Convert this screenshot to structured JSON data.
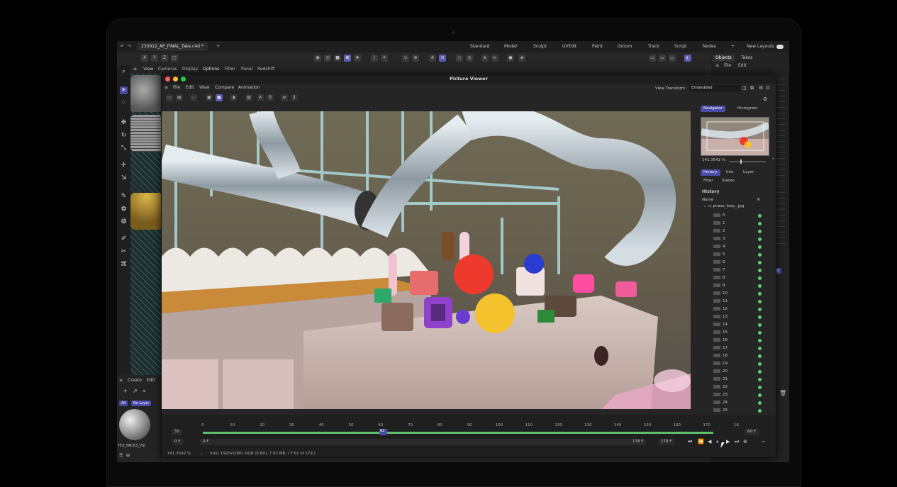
{
  "app": {
    "document_tab": "230912_AP_FINAL_Take.c4d *",
    "layouts": [
      "Standard",
      "Model",
      "Sculpt",
      "UVEdit",
      "Paint",
      "Groom",
      "Track",
      "Script",
      "Nodes"
    ],
    "new_layouts_label": "New Layouts",
    "axis_buttons": [
      "X",
      "Y",
      "Z"
    ],
    "viewport_menu": [
      "View",
      "Cameras",
      "Display",
      "Options",
      "Filter",
      "Panel",
      "Redshift"
    ],
    "right_tabs": [
      "Objects",
      "Takes"
    ],
    "right_menu": [
      "File",
      "Edit"
    ]
  },
  "left_bottom": {
    "menu": [
      "Create",
      "Edit"
    ],
    "chips": [
      "All",
      "No Layer"
    ],
    "material_label": "TEX_PACK3_VSI"
  },
  "picture_viewer": {
    "title": "Picture Viewer",
    "menu": [
      "File",
      "Edit",
      "View",
      "Compare",
      "Animation"
    ],
    "view_transform_label": "View Transform",
    "view_transform_value": "Embedded",
    "tools": [
      "A",
      "B"
    ],
    "side": {
      "top_tabs": [
        "Navigator",
        "Histogram"
      ],
      "zoom": "141.3542 %",
      "tabs_row1": [
        "History",
        "Info",
        "Layer"
      ],
      "tabs_row2": [
        "Filter",
        "Stereo"
      ],
      "section": "History",
      "col_name": "Name",
      "col_r": "R",
      "folder": "phase_loop_.jpg",
      "frames": [
        "0",
        "1",
        "2",
        "3",
        "4",
        "5",
        "6",
        "7",
        "8",
        "9",
        "10",
        "11",
        "12",
        "13",
        "14",
        "15",
        "16",
        "17",
        "18",
        "19",
        "20",
        "21",
        "22",
        "23",
        "24",
        "25"
      ]
    },
    "timeline": {
      "fps": "50",
      "ticks": [
        "0",
        "10",
        "20",
        "30",
        "40",
        "50",
        "60",
        "70",
        "80",
        "90",
        "100",
        "110",
        "120",
        "130",
        "140",
        "150",
        "160",
        "170",
        "18"
      ],
      "playhead_label": "62",
      "end_field": "60 F",
      "start_fields": [
        "0 F",
        "0 F"
      ],
      "frame_fields": [
        "178 F",
        "178 F"
      ],
      "zoom": "141.3542 %",
      "status": "Size: 1920x1080, RGB (8 Bit), 7.92 MB,  ( F 61 of 179 )"
    }
  },
  "colors": {
    "accent": "#5b5bb8",
    "cache": "#5fbf6a",
    "ok": "#5fd071"
  }
}
